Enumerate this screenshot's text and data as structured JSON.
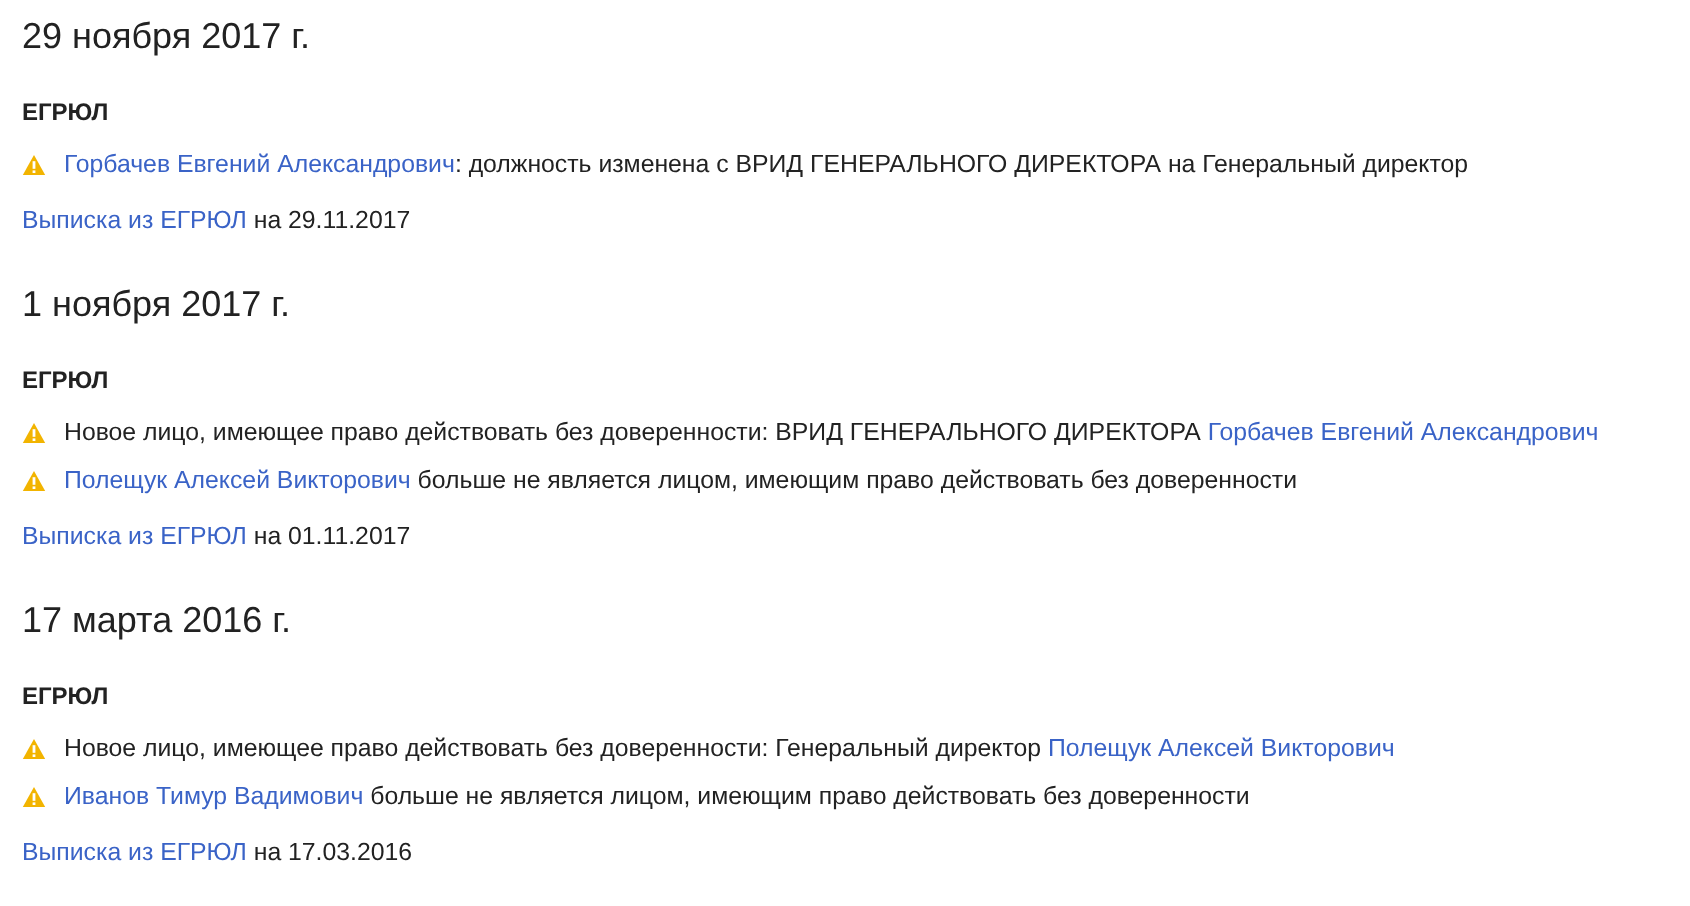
{
  "sections": [
    {
      "date": "29 ноября 2017 г.",
      "source": "ЕГРЮЛ",
      "events": [
        {
          "parts": [
            {
              "kind": "link",
              "text": "Горбачев Евгений Александрович"
            },
            {
              "kind": "text",
              "text": ": должность изменена с ВРИД ГЕНЕРАЛЬНОГО ДИРЕКТОРА на Генеральный директор"
            }
          ]
        }
      ],
      "extract": {
        "link": "Выписка из ЕГРЮЛ",
        "suffix": " на 29.11.2017"
      }
    },
    {
      "date": "1 ноября 2017 г.",
      "source": "ЕГРЮЛ",
      "events": [
        {
          "parts": [
            {
              "kind": "text",
              "text": "Новое лицо, имеющее право действовать без доверенности: ВРИД ГЕНЕРАЛЬНОГО ДИРЕКТОРА "
            },
            {
              "kind": "link",
              "text": "Горбачев Евгений Александрович"
            }
          ]
        },
        {
          "parts": [
            {
              "kind": "link",
              "text": "Полещук Алексей Викторович"
            },
            {
              "kind": "text",
              "text": " больше не является лицом, имеющим право действовать без доверенности"
            }
          ]
        }
      ],
      "extract": {
        "link": "Выписка из ЕГРЮЛ",
        "suffix": " на 01.11.2017"
      }
    },
    {
      "date": "17 марта 2016 г.",
      "source": "ЕГРЮЛ",
      "events": [
        {
          "parts": [
            {
              "kind": "text",
              "text": "Новое лицо, имеющее право действовать без доверенности: Генеральный директор "
            },
            {
              "kind": "link",
              "text": "Полещук Алексей Викторович"
            }
          ]
        },
        {
          "parts": [
            {
              "kind": "link",
              "text": "Иванов Тимур Вадимович"
            },
            {
              "kind": "text",
              "text": " больше не является лицом, имеющим право действовать без доверенности"
            }
          ]
        }
      ],
      "extract": {
        "link": "Выписка из ЕГРЮЛ",
        "suffix": " на 17.03.2016"
      }
    }
  ]
}
